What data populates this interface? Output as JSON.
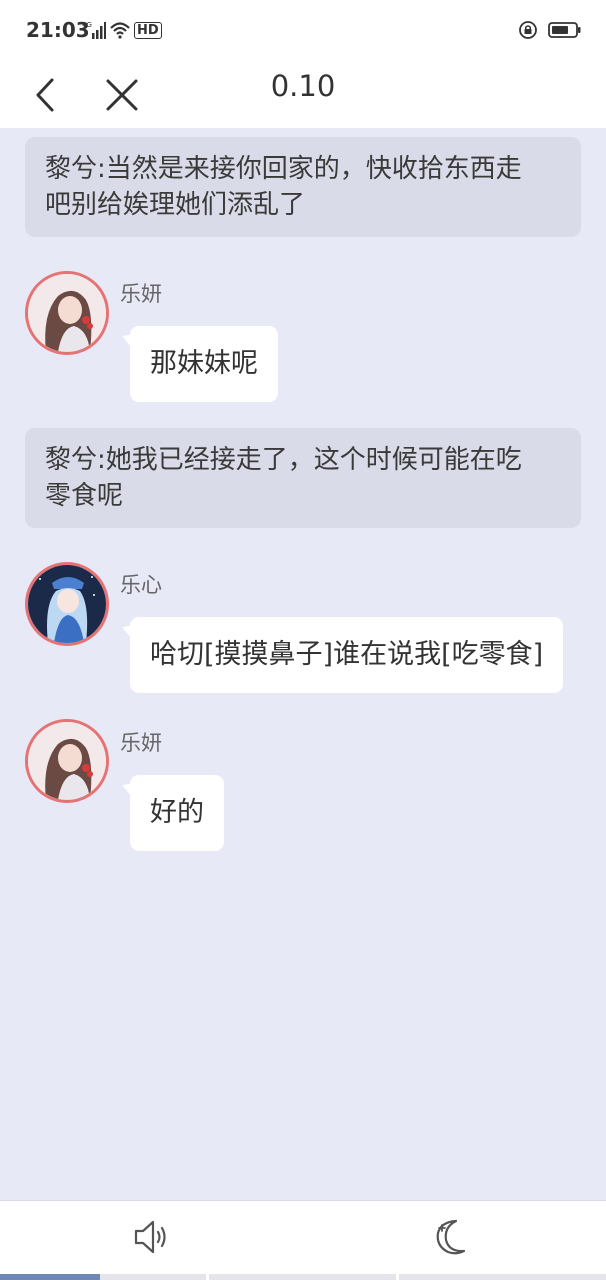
{
  "status_bar": {
    "time": "21:03",
    "network": "4G",
    "hd": "HD",
    "icons": [
      "signal-icon",
      "wifi-icon",
      "hd-icon",
      "lock-rotation-icon",
      "battery-icon"
    ]
  },
  "nav": {
    "title": "0.10",
    "back_icon": "chevron-left-icon",
    "close_icon": "close-icon"
  },
  "messages": [
    {
      "type": "narration",
      "text_line1": "黎兮:当然是来接你回家的，快收拾东西走",
      "text_line2": "吧别给娭理她们添乱了"
    },
    {
      "type": "dialogue",
      "speaker": "乐妍",
      "text": "那妹妹呢"
    },
    {
      "type": "narration",
      "text_line1": "黎兮:她我已经接走了，这个时候可能在吃",
      "text_line2": "零食呢"
    },
    {
      "type": "dialogue",
      "speaker": "乐心",
      "text": "哈切[摸摸鼻子]谁在说我[吃零食]"
    },
    {
      "type": "dialogue",
      "speaker": "乐妍",
      "text": "好的"
    }
  ],
  "bottom_bar": {
    "sound_icon": "speaker-icon",
    "night_icon": "moon-icon"
  },
  "reading_progress": 0.165,
  "colors": {
    "background": "#e8e9f7",
    "narration_bg": "#d9dbe8",
    "bubble_bg": "#ffffff",
    "avatar_border": "#e57373",
    "progress": "#6f87b7"
  }
}
